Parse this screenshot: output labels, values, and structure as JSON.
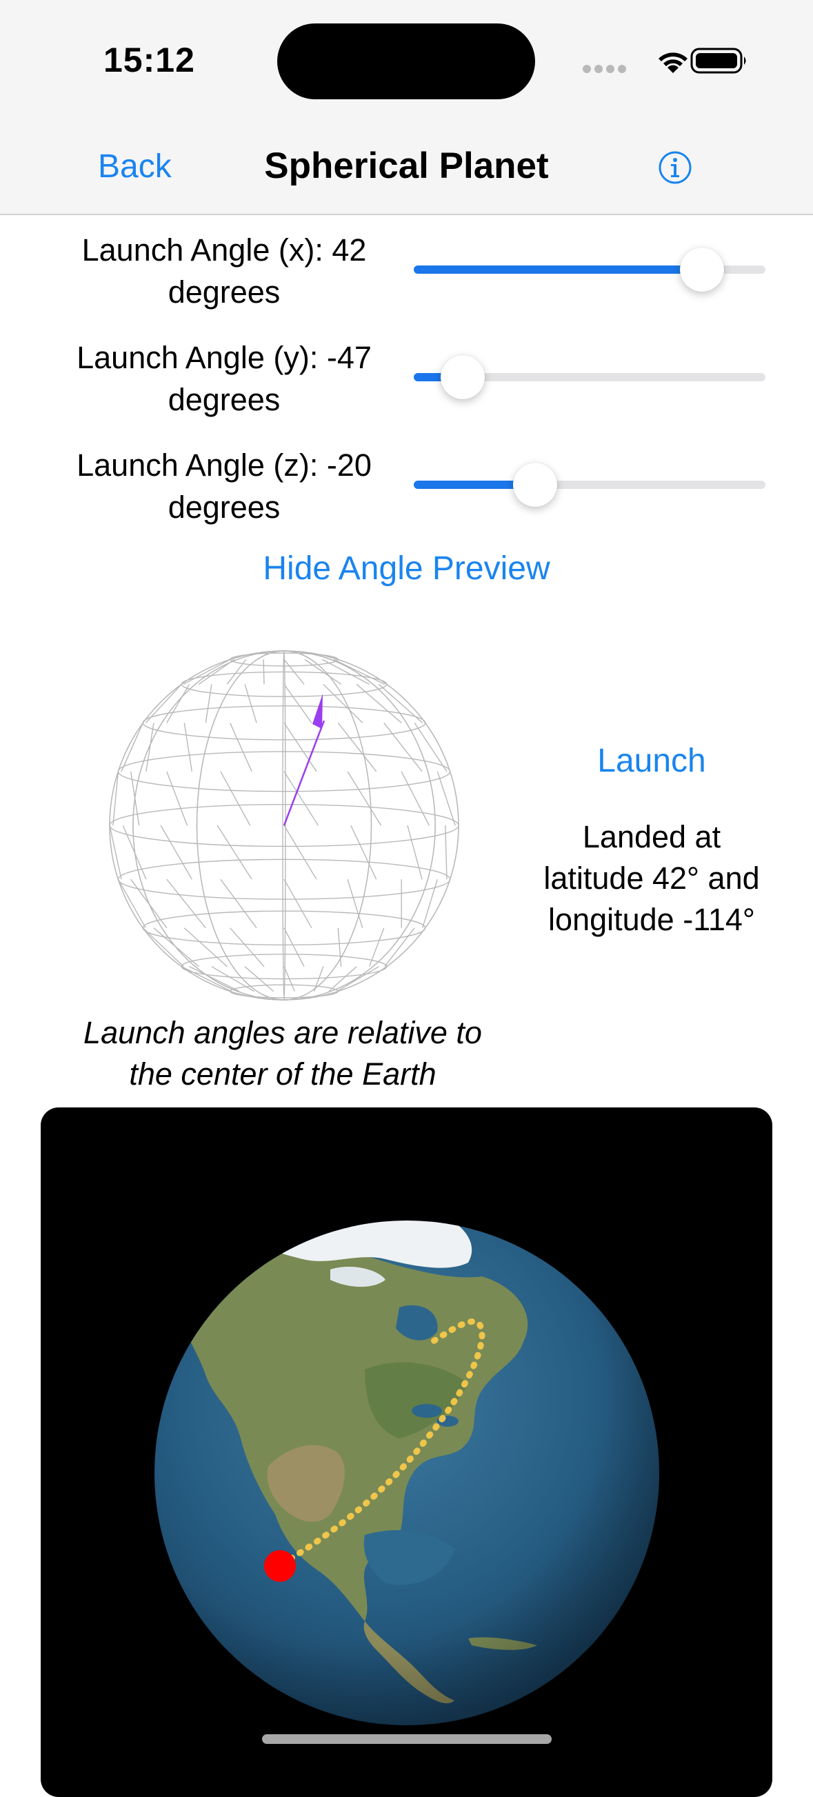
{
  "status_bar": {
    "time": "15:12"
  },
  "nav": {
    "back_label": "Back",
    "title": "Spherical Planet"
  },
  "controls": {
    "sliders": [
      {
        "label_line1": "Launch Angle (x): 42",
        "label_line2": "degrees",
        "value": 42,
        "fraction": 0.82
      },
      {
        "label_line1": "Launch Angle (y): -47",
        "label_line2": "degrees",
        "value": -47,
        "fraction": 0.14
      },
      {
        "label_line1": "Launch Angle (z): -20",
        "label_line2": "degrees",
        "value": -20,
        "fraction": 0.345
      }
    ],
    "preview_toggle_label": "Hide Angle Preview",
    "launch_label": "Launch"
  },
  "result": {
    "line1": "Landed at",
    "line2": "latitude 42° and",
    "line3": "longitude -114°"
  },
  "caption": {
    "line1": "Launch angles are relative to",
    "line2": "the center of the Earth"
  },
  "colors": {
    "accent": "#1a84ef",
    "slider_fill": "#1a76ea",
    "arrow": "#9a3ef0",
    "trajectory": "#f5c94a",
    "landing_marker": "#ff0000"
  }
}
